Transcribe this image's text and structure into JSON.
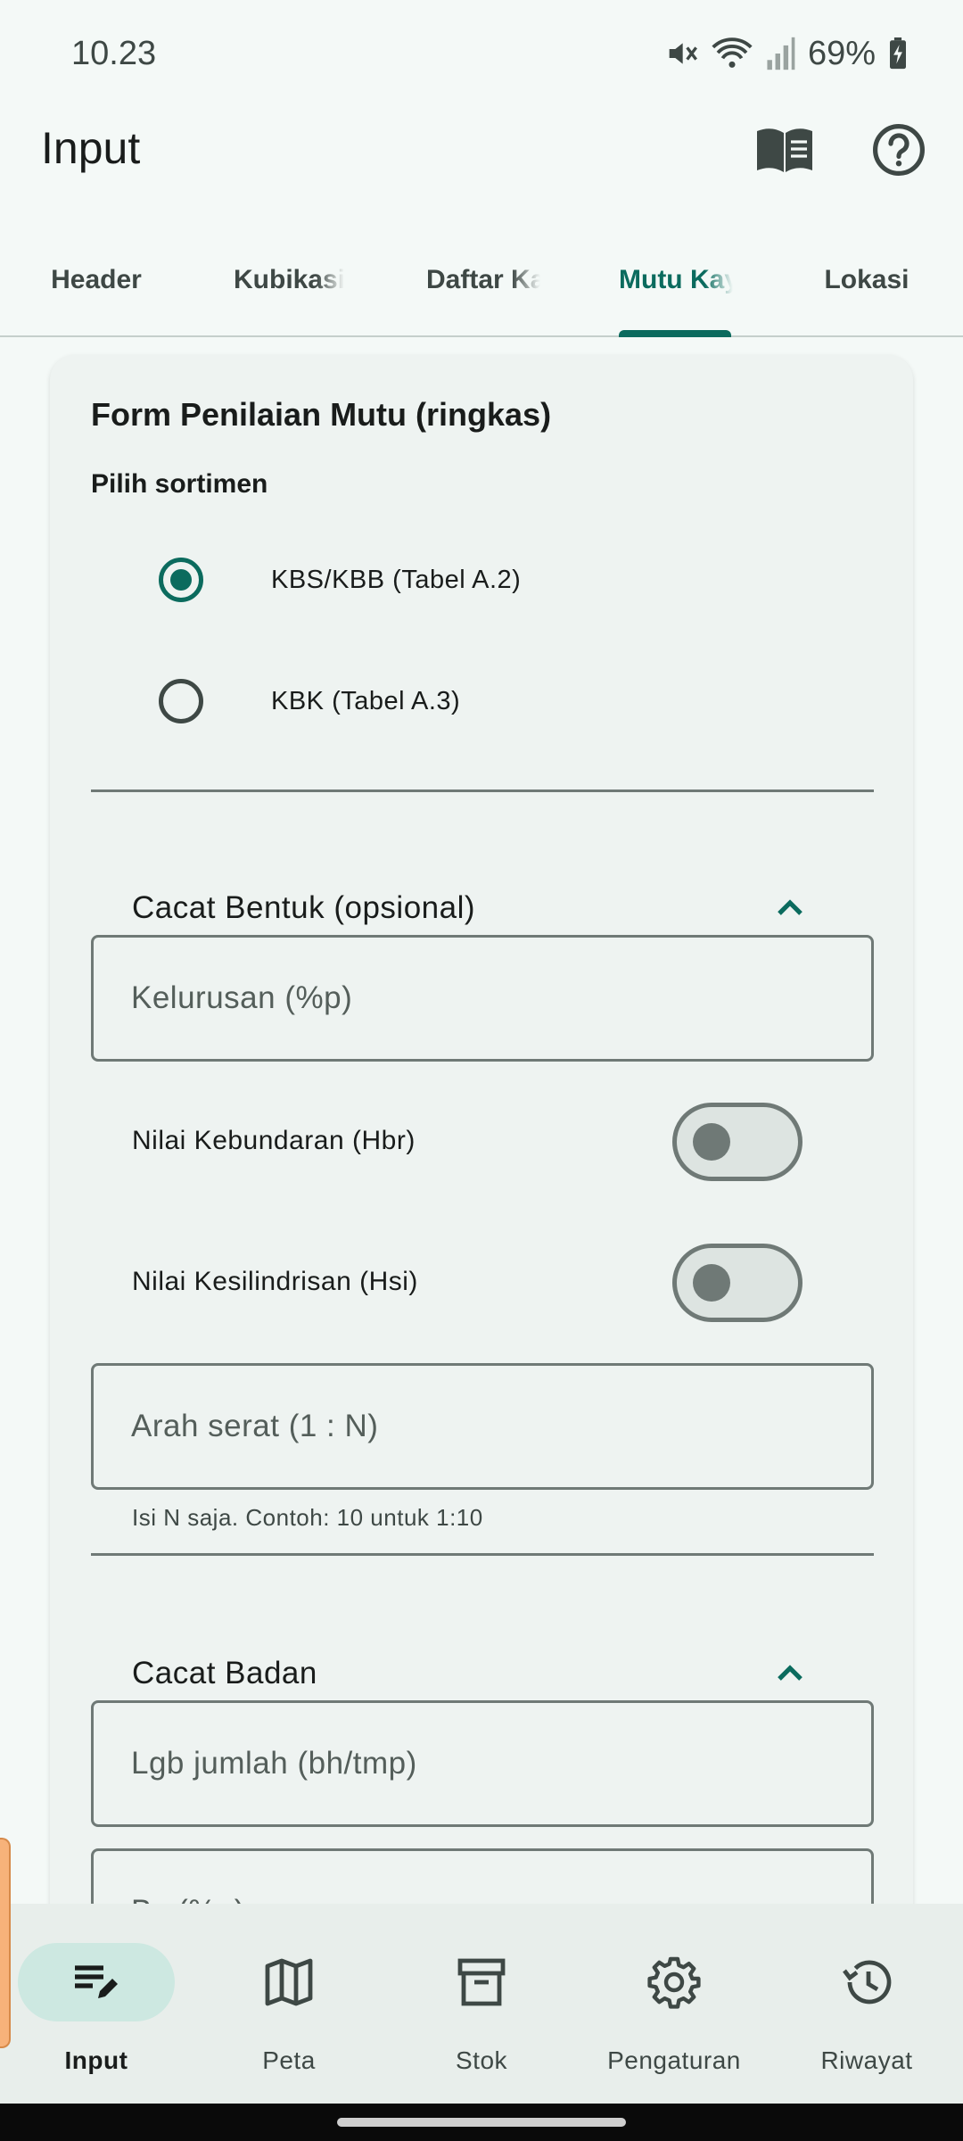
{
  "status_bar": {
    "time": "10.23",
    "battery": "69%"
  },
  "app_bar": {
    "title": "Input"
  },
  "tabs": [
    {
      "label": "Header"
    },
    {
      "label": "Kubikasi"
    },
    {
      "label": "Daftar Kayu"
    },
    {
      "label": "Mutu Kayu"
    },
    {
      "label": "Lokasi"
    }
  ],
  "form": {
    "title": "Form Penilaian Mutu (ringkas)",
    "sortimen_label": "Pilih sortimen",
    "options": [
      {
        "label": "KBS/KBB  (Tabel A.2)",
        "selected": true
      },
      {
        "label": "KBK  (Tabel A.3)",
        "selected": false
      }
    ],
    "cacat_bentuk": {
      "title": "Cacat Bentuk (opsional)",
      "kelurusan_placeholder": "Kelurusan (%p)",
      "kebundaran_label": "Nilai Kebundaran (Hbr)",
      "kesilindrisan_label": "Nilai Kesilindrisan (Hsi)",
      "arah_serat_placeholder": "Arah serat (1 : N)",
      "arah_serat_helper": "Isi N saja. Contoh: 10 untuk 1:10"
    },
    "cacat_badan": {
      "title": "Cacat Badan",
      "lgb_placeholder": "Lgb jumlah (bh/tmp)",
      "next_placeholder": "Bc (%p)"
    }
  },
  "bottom_nav": [
    {
      "label": "Input",
      "icon": "edit-note-icon",
      "active": true
    },
    {
      "label": "Peta",
      "icon": "map-icon",
      "active": false
    },
    {
      "label": "Stok",
      "icon": "archive-box-icon",
      "active": false
    },
    {
      "label": "Pengaturan",
      "icon": "gear-icon",
      "active": false
    },
    {
      "label": "Riwayat",
      "icon": "history-icon",
      "active": false
    }
  ],
  "colors": {
    "primary": "#0b6b5e",
    "background": "#f4f9f7",
    "card": "#eef3f1",
    "nav_pill": "#cde8e1"
  }
}
